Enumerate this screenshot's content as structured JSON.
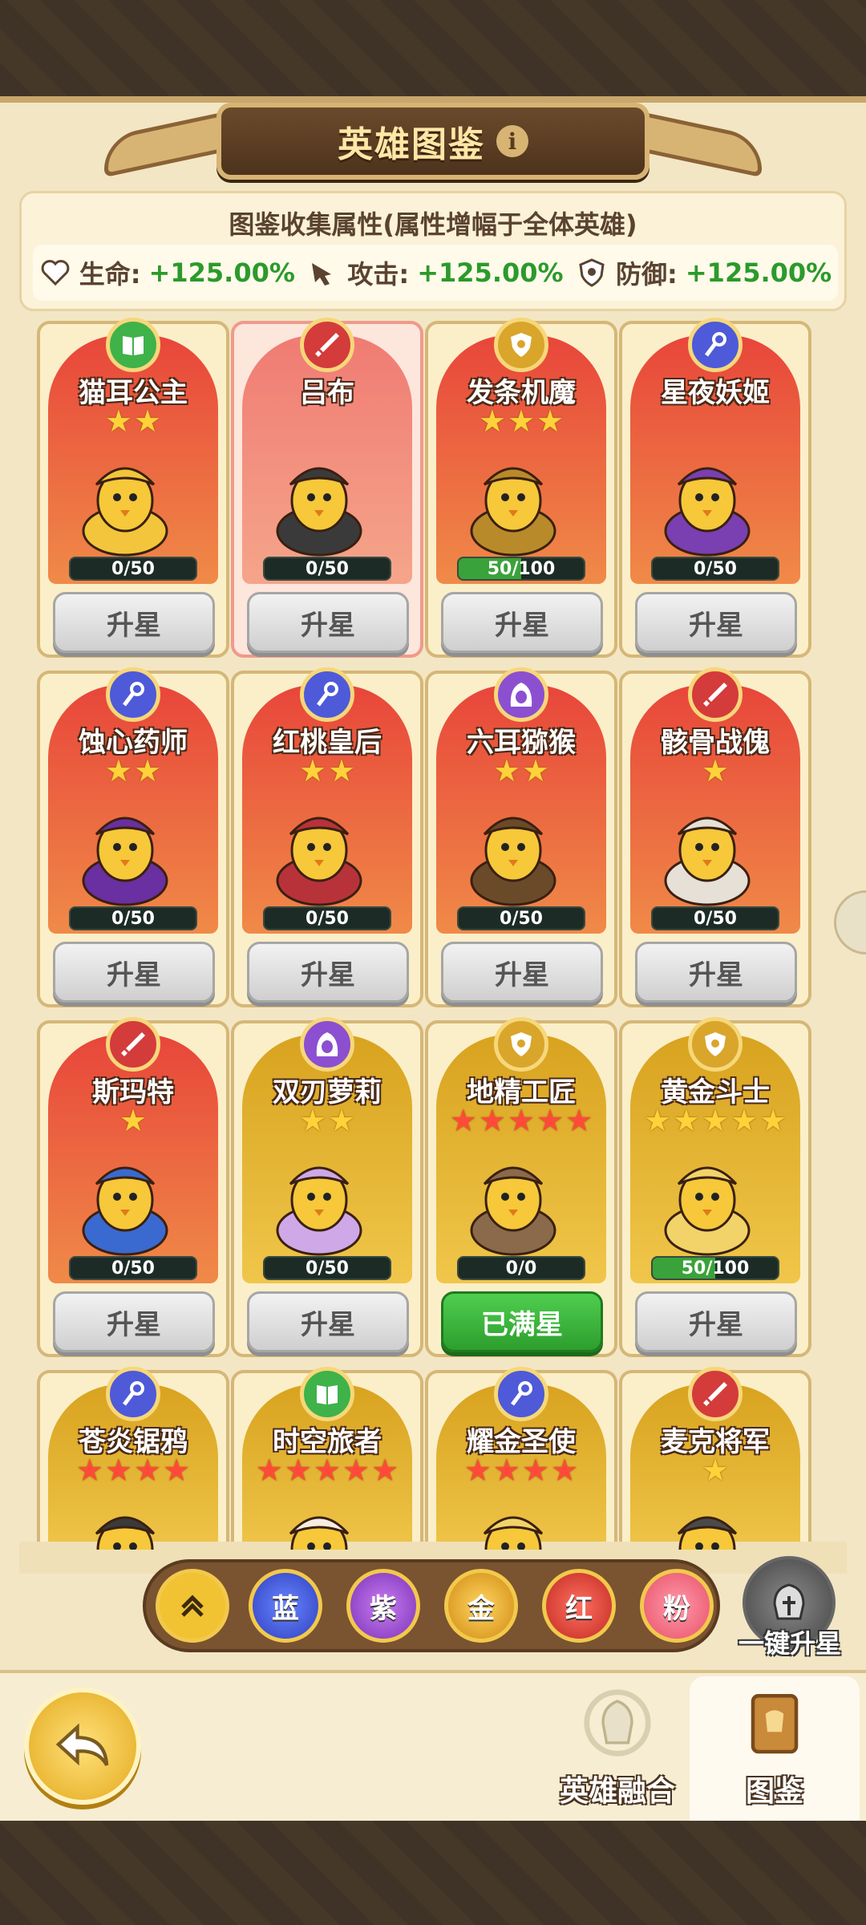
{
  "header": {
    "title": "英雄图鉴",
    "info_icon": "info-icon"
  },
  "collection": {
    "title": "图鉴收集属性(属性增幅于全体英雄)",
    "stats": [
      {
        "icon": "heart-icon",
        "label": "生命:",
        "value": "+125.00%"
      },
      {
        "icon": "attack-icon",
        "label": "攻击:",
        "value": "+125.00%"
      },
      {
        "icon": "shield-icon",
        "label": "防御:",
        "value": "+125.00%"
      }
    ]
  },
  "heroes": [
    {
      "name": "猫耳公主",
      "stars": 2,
      "star_color": "gold",
      "progress_text": "0/50",
      "progress": 0,
      "button": "升星",
      "class_icon": "book-icon",
      "class_color": "#3fb24a",
      "bg": "red"
    },
    {
      "name": "吕布",
      "stars": 0,
      "star_color": "gold",
      "progress_text": "0/50",
      "progress": 0,
      "button": "升星",
      "class_icon": "sword-icon",
      "class_color": "#d43b3b",
      "bg": "pink"
    },
    {
      "name": "发条机魔",
      "stars": 3,
      "star_color": "gold",
      "progress_text": "50/100",
      "progress": 0.5,
      "button": "升星",
      "class_icon": "shield-icon",
      "class_color": "#d9a52b",
      "bg": "red"
    },
    {
      "name": "星夜妖姬",
      "stars": 0,
      "star_color": "gold",
      "progress_text": "0/50",
      "progress": 0,
      "button": "升星",
      "class_icon": "staff-icon",
      "class_color": "#4e5ad8",
      "bg": "red"
    },
    {
      "name": "蚀心药师",
      "stars": 2,
      "star_color": "gold",
      "progress_text": "0/50",
      "progress": 0,
      "button": "升星",
      "class_icon": "staff-icon",
      "class_color": "#4e5ad8",
      "bg": "red"
    },
    {
      "name": "红桃皇后",
      "stars": 2,
      "star_color": "gold",
      "progress_text": "0/50",
      "progress": 0,
      "button": "升星",
      "class_icon": "staff-icon",
      "class_color": "#4e5ad8",
      "bg": "red"
    },
    {
      "name": "六耳猕猴",
      "stars": 2,
      "star_color": "gold",
      "progress_text": "0/50",
      "progress": 0,
      "button": "升星",
      "class_icon": "hood-icon",
      "class_color": "#8c4fd0",
      "bg": "red"
    },
    {
      "name": "骸骨战傀",
      "stars": 1,
      "star_color": "gold",
      "progress_text": "0/50",
      "progress": 0,
      "button": "升星",
      "class_icon": "sword-icon",
      "class_color": "#d43b3b",
      "bg": "red"
    },
    {
      "name": "斯玛特",
      "stars": 1,
      "star_color": "gold",
      "progress_text": "0/50",
      "progress": 0,
      "button": "升星",
      "class_icon": "sword-icon",
      "class_color": "#d43b3b",
      "bg": "red"
    },
    {
      "name": "双刃萝莉",
      "stars": 2,
      "star_color": "gold",
      "progress_text": "0/50",
      "progress": 0,
      "button": "升星",
      "class_icon": "hood-icon",
      "class_color": "#8c4fd0",
      "bg": "gold"
    },
    {
      "name": "地精工匠",
      "stars": 5,
      "star_color": "red",
      "progress_text": "0/0",
      "progress": 0,
      "button": "已满星",
      "class_icon": "shield-icon",
      "class_color": "#d9a52b",
      "bg": "gold"
    },
    {
      "name": "黄金斗士",
      "stars": 5,
      "star_color": "gold",
      "progress_text": "50/100",
      "progress": 0.5,
      "button": "升星",
      "class_icon": "shield-icon",
      "class_color": "#d9a52b",
      "bg": "gold"
    },
    {
      "name": "苍炎锯鸦",
      "stars": 4,
      "star_color": "red",
      "class_icon": "staff-icon",
      "class_color": "#4e5ad8",
      "bg": "gold"
    },
    {
      "name": "时空旅者",
      "stars": 5,
      "star_color": "red",
      "class_icon": "book-icon",
      "class_color": "#3fb24a",
      "bg": "gold"
    },
    {
      "name": "耀金圣使",
      "stars": 4,
      "star_color": "red",
      "class_icon": "staff-icon",
      "class_color": "#4e5ad8",
      "bg": "gold"
    },
    {
      "name": "麦克将军",
      "stars": 1,
      "star_color": "gold",
      "class_icon": "sword-icon",
      "class_color": "#d43b3b",
      "bg": "gold"
    }
  ],
  "filters": {
    "up_icon": "double-chevron-up-icon",
    "items": [
      "蓝",
      "紫",
      "金",
      "红",
      "粉"
    ],
    "one_click": "一键升星"
  },
  "bottom_nav": {
    "fusion": "英雄融合",
    "codex": "图鉴"
  }
}
